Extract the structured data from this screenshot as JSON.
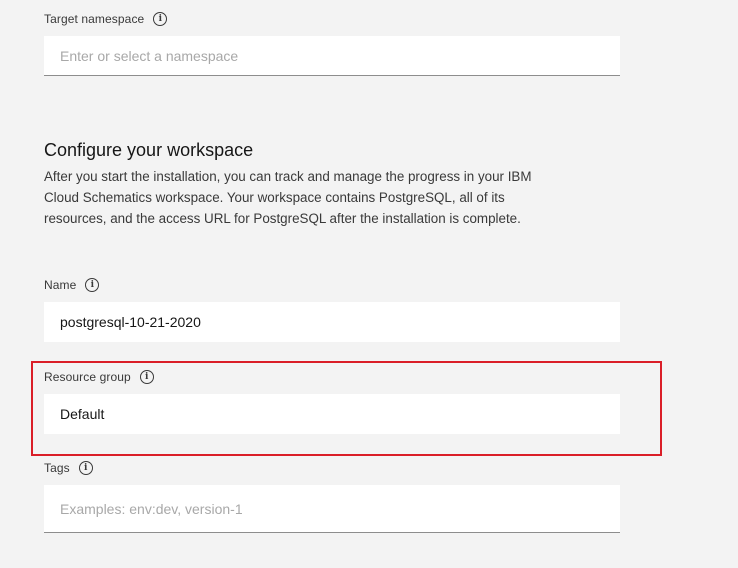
{
  "target_namespace": {
    "label": "Target namespace",
    "info_icon": "info-icon",
    "placeholder": "Enter or select a namespace",
    "value": ""
  },
  "workspace": {
    "title": "Configure your workspace",
    "description": "After you start the installation, you can track and manage the progress in your IBM Cloud Schematics workspace. Your workspace contains PostgreSQL, all of its resources, and the access URL for PostgreSQL after the installation is complete."
  },
  "name": {
    "label": "Name",
    "info_icon": "info-icon",
    "value": "postgresql-10-21-2020"
  },
  "resource_group": {
    "label": "Resource group",
    "info_icon": "info-icon",
    "value": "Default",
    "highlight_color": "#da1e28"
  },
  "tags": {
    "label": "Tags",
    "info_icon": "info-icon",
    "placeholder": "Examples: env:dev, version-1",
    "value": ""
  }
}
